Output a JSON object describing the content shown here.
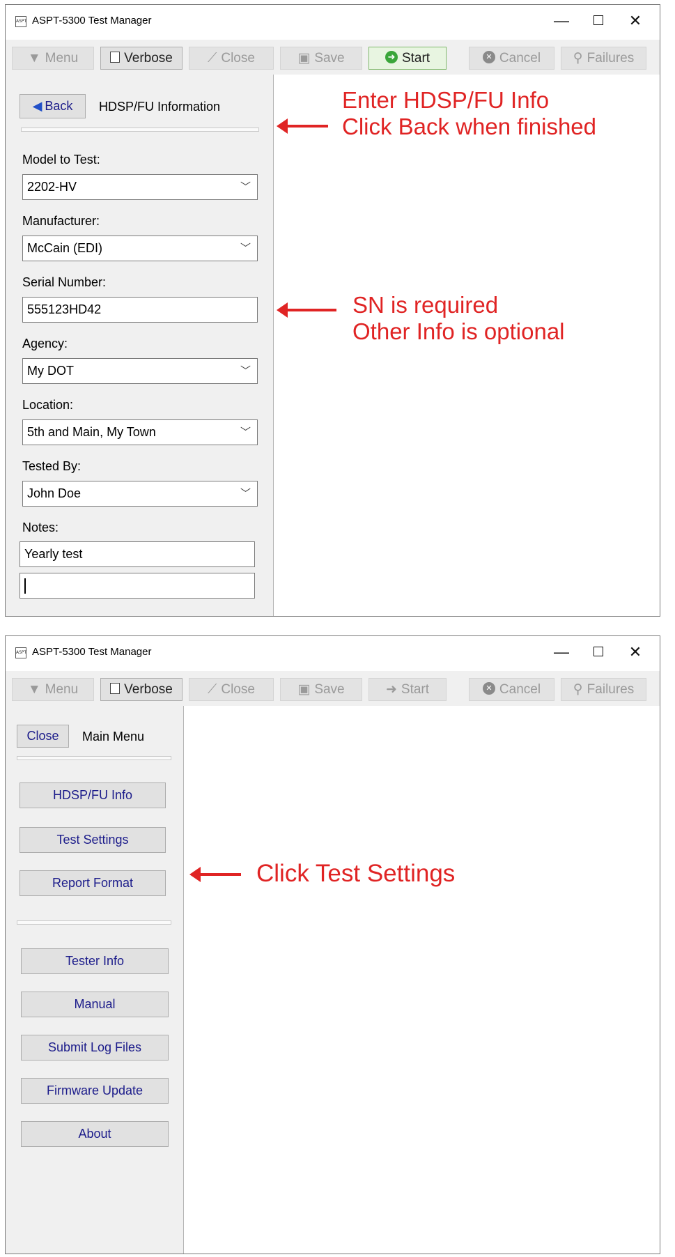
{
  "window_title": "ASPT-5300 Test Manager",
  "app_icon_text": "ASPT",
  "window_controls": {
    "minimize": "—",
    "close": "✕"
  },
  "toolbar": {
    "menu": "Menu",
    "verbose": "Verbose",
    "close": "Close",
    "save": "Save",
    "start": "Start",
    "cancel": "Cancel",
    "failures": "Failures"
  },
  "screen1": {
    "back_label": "Back",
    "panel_title": "HDSP/FU Information",
    "fields": [
      {
        "label": "Model to Test:",
        "value": "2202-HV"
      },
      {
        "label": "Manufacturer:",
        "value": "McCain (EDI)"
      },
      {
        "label": "Serial Number:",
        "value": "555123HD42"
      },
      {
        "label": "Agency:",
        "value": "My DOT"
      },
      {
        "label": "Location:",
        "value": "5th and Main, My Town"
      },
      {
        "label": "Tested By:",
        "value": "John Doe"
      }
    ],
    "notes_label": "Notes:",
    "notes_line1": "Yearly test",
    "notes_line2": "",
    "annotations": {
      "top_line1": "Enter HDSP/FU  Info",
      "top_line2": "Click Back when finished",
      "mid_line1": "SN is required",
      "mid_line2": "Other Info is optional"
    }
  },
  "screen2": {
    "close_label": "Close",
    "panel_title": "Main Menu",
    "menu_group1": [
      "HDSP/FU Info",
      "Test Settings",
      "Report Format"
    ],
    "menu_group2": [
      "Tester Info",
      "Manual",
      "Submit Log Files",
      "Firmware Update",
      "About"
    ],
    "annotation": "Click Test Settings"
  }
}
